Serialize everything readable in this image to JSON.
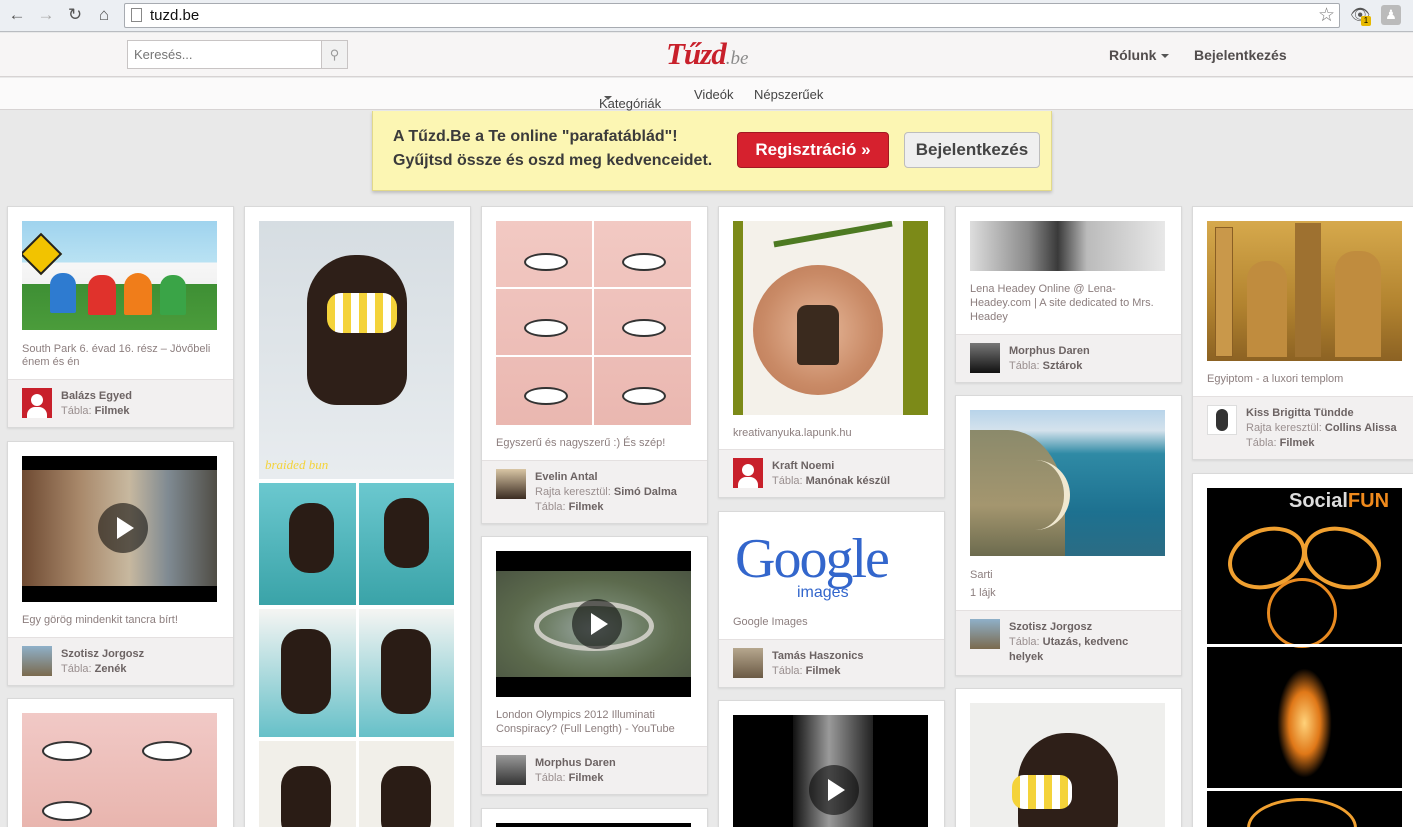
{
  "browser": {
    "url": "tuzd.be"
  },
  "header": {
    "search_placeholder": "Keresés...",
    "logo_main": "Tűzd",
    "logo_suffix": ".be",
    "about_label": "Rólunk",
    "login_label": "Bejelentkezés"
  },
  "subnav": {
    "categories": "Kategóriák",
    "videos": "Videók",
    "popular": "Népszerűek"
  },
  "banner": {
    "line1": "A Tűzd.Be a Te online \"parafatáblád\"!",
    "line2": "Gyűjtsd össze és oszd meg kedvenceidet.",
    "register": "Regisztráció »",
    "login": "Bejelentkezés"
  },
  "board_label": "Tábla:",
  "via_label": "Rajta keresztül:",
  "pins": [
    {
      "desc1": "South Park 6. évad 16. rész – Jövőbeli",
      "desc2": "énem és én",
      "user": "Balázs Egyed",
      "board": "Filmek"
    },
    {
      "desc1": "Egy görög mindenkit tancra bírt!",
      "user": "Szotisz Jorgosz",
      "board": "Zenék"
    },
    {
      "desc1": "Egyszerű és nagyszerű :) És szép!",
      "user": "Evelin Antal",
      "via": "Simó Dalma",
      "board": "Filmek"
    },
    {
      "desc1": "London Olympics 2012 Illuminati",
      "desc2": "Conspiracy? (Full Length) - YouTube",
      "user": "Morphus Daren",
      "board": "Filmek"
    },
    {
      "desc1": "kreativanyuka.lapunk.hu",
      "user": "Kraft Noemi",
      "board": "Manónak készül"
    },
    {
      "desc1": "Google Images",
      "user": "Tamás Haszonics",
      "board": "Filmek"
    },
    {
      "desc1": "Lena Headey Online @ Lena-",
      "desc2": "Headey.com | A site dedicated to Mrs.",
      "desc3": "Headey",
      "user": "Morphus Daren",
      "board": "Sztárok"
    },
    {
      "desc1": "Sarti",
      "likes": "1 lájk",
      "user": "Szotisz Jorgosz",
      "board": "Utazás, kedvenc",
      "board2": "helyek"
    },
    {
      "desc1": "Egyiptom - a luxori templom",
      "user": "Kiss Brigitta Tündde",
      "via": "Collins Alissa",
      "board": "Filmek"
    }
  ],
  "image_text": {
    "braided_bun": "braided bun",
    "google_logo": "Google",
    "google_images": "images",
    "socialfun_a": "Social",
    "socialfun_b": "FUN"
  }
}
